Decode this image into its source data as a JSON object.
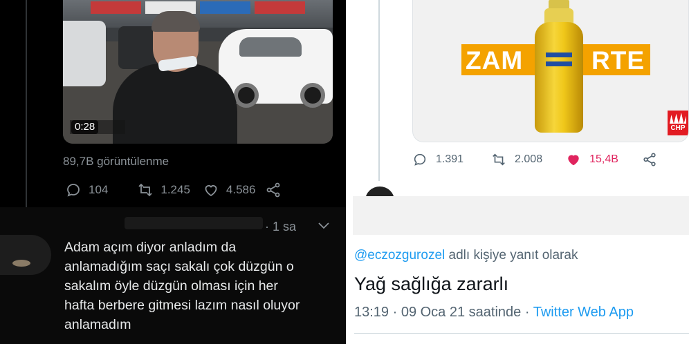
{
  "left_tweet": {
    "video": {
      "duration": "0:28"
    },
    "views": "89,7B görüntülenme",
    "actions": {
      "replies": "104",
      "retweets": "1.245",
      "likes": "4.586"
    }
  },
  "left_reply": {
    "time": "· 1 sa",
    "text_lines": [
      "Adam açım diyor anladım da",
      "anlamadığım saçı sakalı çok düzgün o",
      "sakalım öyle düzgün olması için her",
      "hafta berbere gitmesi lazım nasıl oluyor",
      "anlamadım"
    ]
  },
  "right_tweet": {
    "ad": {
      "word_left": "ZAM",
      "word_right": "RTE",
      "logo": "CHP"
    },
    "actions": {
      "replies": "1.391",
      "retweets": "2.008",
      "likes": "15,4B"
    }
  },
  "right_reply": {
    "reply_handle": "@eczozgurozel",
    "reply_suffix": " adlı kişiye yanıt olarak",
    "text": "Yağ sağlığa zararlı",
    "time": "13:19 · 09 Oca 21 saatinde · ",
    "app": "Twitter Web App"
  },
  "colors": {
    "accent": "#1d9bf0",
    "like": "#e0245e",
    "dark_bg": "#000000",
    "light_bg": "#ffffff"
  }
}
